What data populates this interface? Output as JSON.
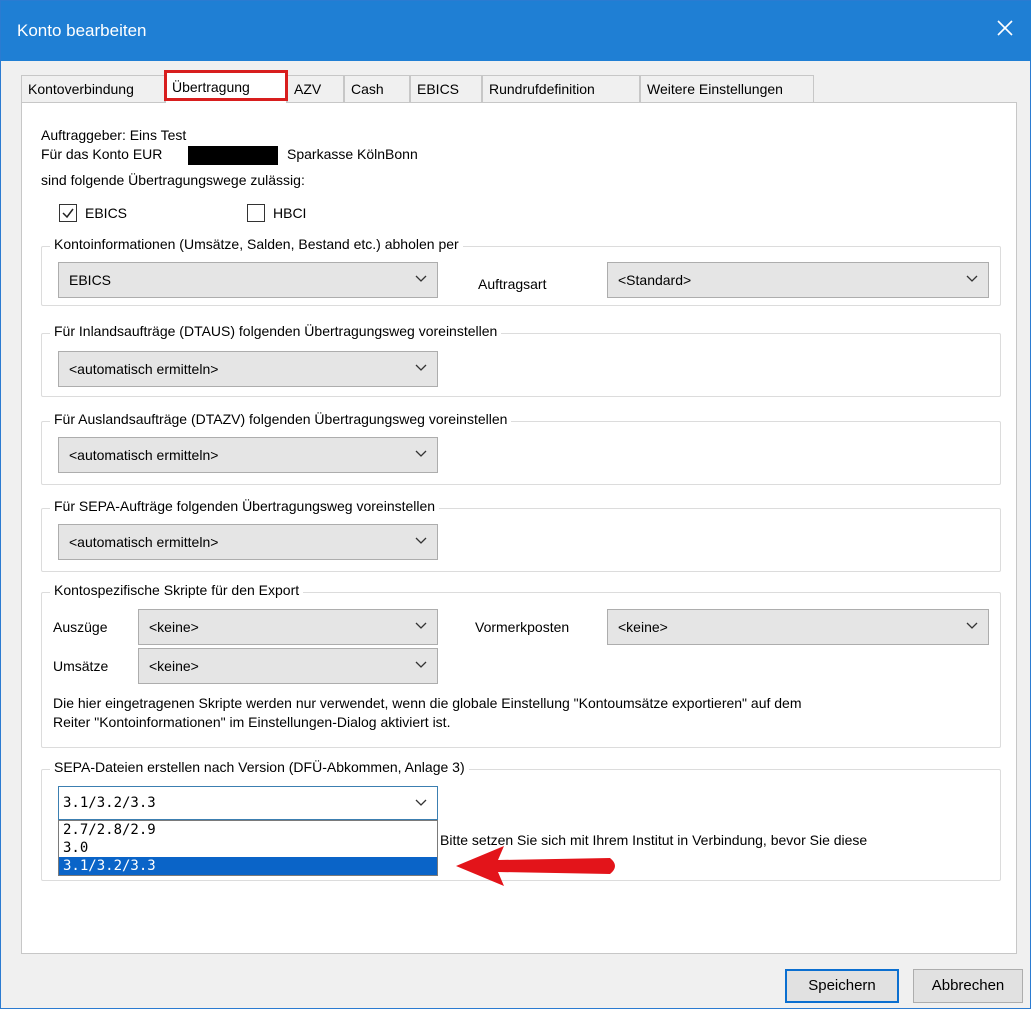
{
  "window": {
    "title": "Konto bearbeiten",
    "close_icon": "close-icon"
  },
  "tabs": [
    {
      "label": "Kontoverbindung"
    },
    {
      "label": "Übertragung",
      "active": true,
      "highlight_color": "#d81e1e"
    },
    {
      "label": "AZV"
    },
    {
      "label": "Cash"
    },
    {
      "label": "EBICS"
    },
    {
      "label": "Rundrufdefinition"
    },
    {
      "label": "Weitere Einstellungen"
    }
  ],
  "info": {
    "auftraggeber": "Auftraggeber: Eins Test",
    "konto_prefix": "Für das Konto EUR",
    "bank": "Sparkasse KölnBonn",
    "line3": "sind folgende Übertragungswege zulässig:"
  },
  "methods": {
    "ebics": {
      "label": "EBICS",
      "checked": true
    },
    "hbci": {
      "label": "HBCI",
      "checked": false
    }
  },
  "kontoinformationen": {
    "legend": "Kontoinformationen (Umsätze, Salden, Bestand etc.) abholen per",
    "method_value": "EBICS",
    "auftragsart_label": "Auftragsart",
    "auftragsart_value": "<Standard>"
  },
  "inland": {
    "legend": "Für Inlandsaufträge (DTAUS) folgenden Übertragungsweg voreinstellen",
    "value": "<automatisch ermitteln>"
  },
  "ausland": {
    "legend": "Für Auslandsaufträge (DTAZV) folgenden Übertragungsweg voreinstellen",
    "value": "<automatisch ermitteln>"
  },
  "sepa_weg": {
    "legend": "Für SEPA-Aufträge folgenden Übertragungsweg voreinstellen",
    "value": "<automatisch ermitteln>"
  },
  "skripte": {
    "legend": "Kontospezifische Skripte für den Export",
    "auszuege_label": "Auszüge",
    "auszuege_value": "<keine>",
    "vormerk_label": "Vormerkposten",
    "vormerk_value": "<keine>",
    "umsaetze_label": "Umsätze",
    "umsaetze_value": "<keine>",
    "note_line1": "Die hier eingetragenen Skripte werden nur verwendet, wenn die globale Einstellung \"Kontoumsätze exportieren\" auf dem",
    "note_line2": "Reiter \"Kontoinformationen\" im Einstellungen-Dialog aktiviert ist."
  },
  "sepa_version": {
    "legend": "SEPA-Dateien erstellen nach Version (DFÜ-Abkommen, Anlage 3)",
    "value": "3.1/3.2/3.3",
    "options": [
      "2.7/2.8/2.9",
      "3.0",
      "3.1/3.2/3.3"
    ],
    "selected_index": 2,
    "hint": "Bitte setzen Sie sich mit Ihrem Institut in Verbindung, bevor Sie diese",
    "arrow_color": "#e3141a"
  },
  "buttons": {
    "save": "Speichern",
    "cancel": "Abbrechen"
  }
}
